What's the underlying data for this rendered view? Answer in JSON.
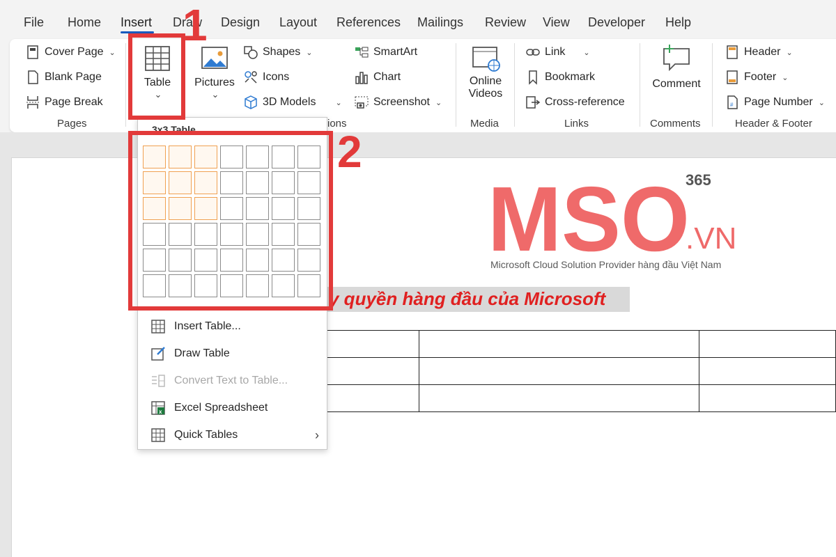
{
  "menu": {
    "tabs": [
      "File",
      "Home",
      "Insert",
      "Draw",
      "Design",
      "Layout",
      "References",
      "Mailings",
      "Review",
      "View",
      "Developer",
      "Help"
    ],
    "active": "Insert"
  },
  "ribbon": {
    "pages": {
      "cover": "Cover Page",
      "blank": "Blank Page",
      "break": "Page Break",
      "label": "Pages"
    },
    "table": {
      "label": "Table"
    },
    "illustrations": {
      "pictures": "Pictures",
      "shapes": "Shapes",
      "icons": "Icons",
      "models": "3D Models",
      "smartart": "SmartArt",
      "chart": "Chart",
      "screenshot": "Screenshot",
      "label_tail": "ions"
    },
    "media": {
      "online": "Online",
      "videos": "Videos",
      "label": "Media"
    },
    "links": {
      "link": "Link",
      "bookmark": "Bookmark",
      "crossref": "Cross-reference",
      "label": "Links"
    },
    "comments": {
      "comment": "Comment",
      "label": "Comments"
    },
    "header_footer": {
      "header": "Header",
      "footer": "Footer",
      "page_number": "Page Number",
      "label": "Header & Footer"
    }
  },
  "dropdown": {
    "title": "3x3 Table",
    "grid": {
      "cols": 7,
      "rows": 6,
      "selected_cols": 3,
      "selected_rows": 3
    },
    "items": [
      {
        "label": "Insert Table...",
        "enabled": true
      },
      {
        "label": "Draw Table",
        "enabled": true
      },
      {
        "label": "Convert Text to Table...",
        "enabled": false
      },
      {
        "label": "Excel Spreadsheet",
        "enabled": true
      },
      {
        "label": "Quick Tables",
        "enabled": true
      }
    ]
  },
  "document": {
    "logo": {
      "brand": "MSO",
      "suffix": ".VN",
      "superscript": "365",
      "tagline": "Microsoft Cloud Solution Provider hàng đầu Việt Nam"
    },
    "highlighted_text": "y quyền hàng đầu của Microsoft"
  },
  "callouts": {
    "one": "1",
    "two": "2"
  },
  "colors": {
    "accent": "#185abd",
    "callout": "#e23a3a",
    "logo": "#ef6a6a",
    "selection": "#f0a050"
  }
}
